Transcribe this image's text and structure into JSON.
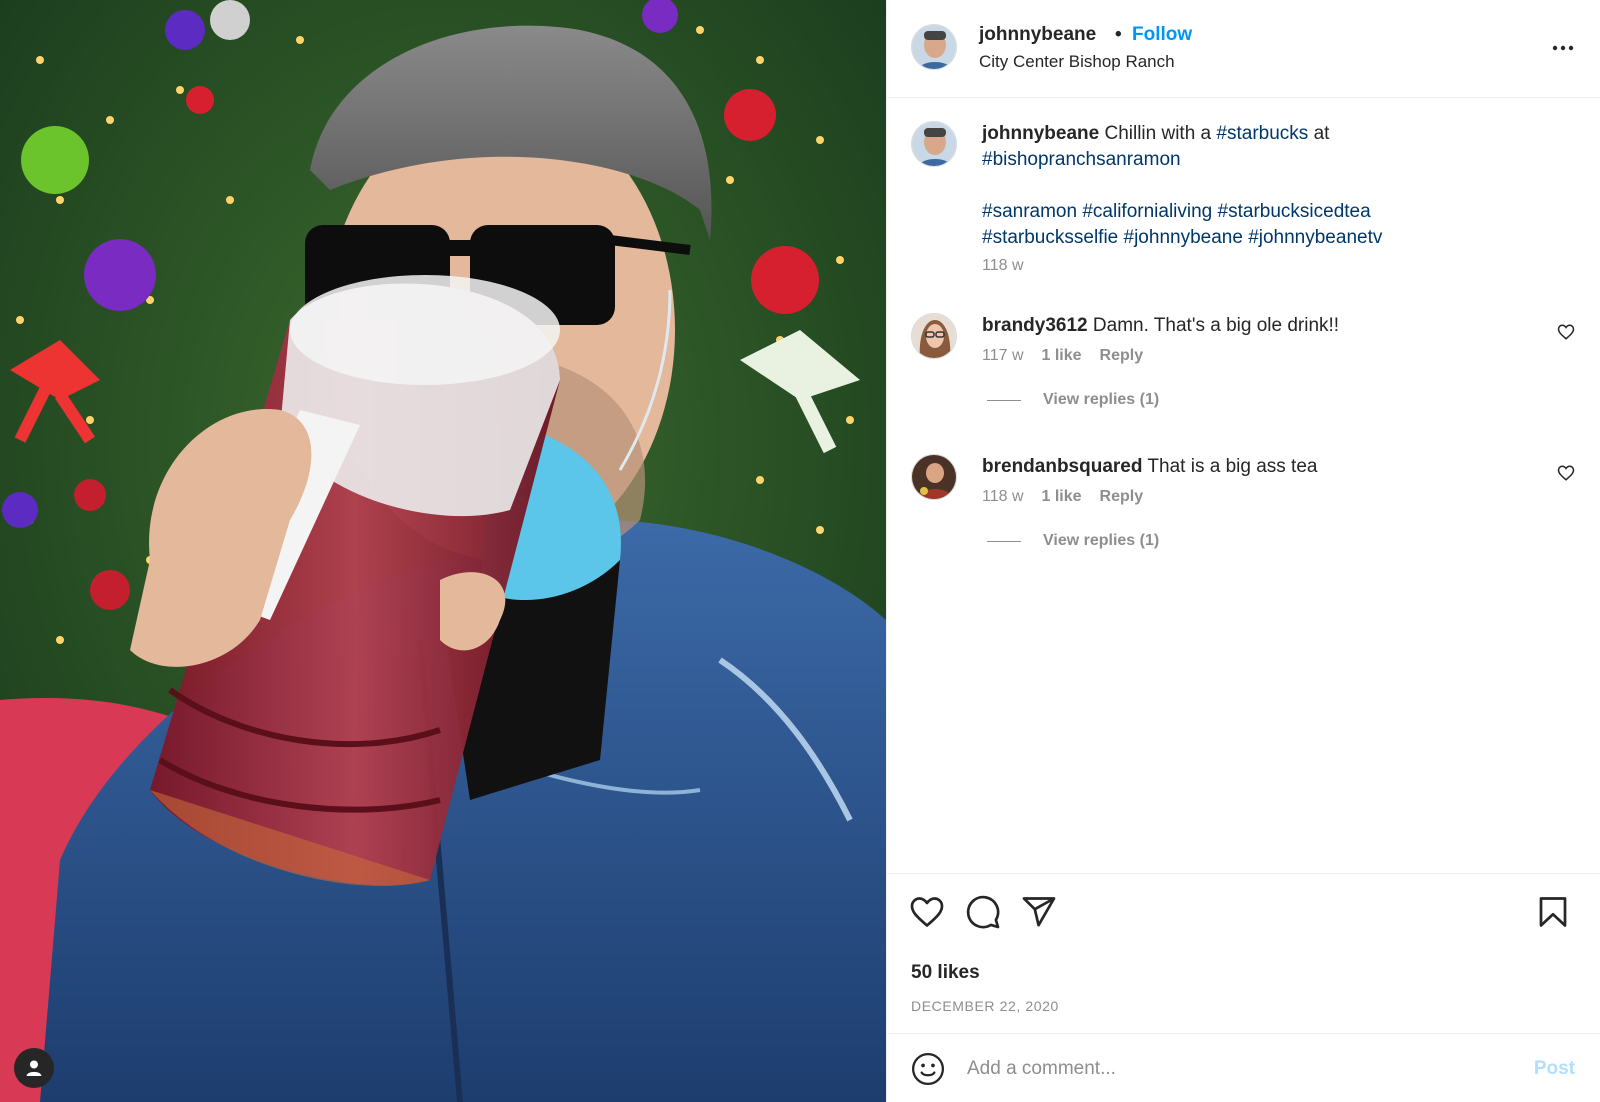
{
  "post": {
    "username": "johnnybeane",
    "follow_label": "Follow",
    "separator": "•",
    "location": "City Center Bishop Ranch",
    "caption": {
      "username": "johnnybeane",
      "text_1": "Chillin with a",
      "tag_1": "#starbucks",
      "text_2": "at",
      "tag_2": "#bishopranchsanramon",
      "tags_line_1": [
        "#sanramon",
        "#californialiving",
        "#starbucksicedtea"
      ],
      "tags_line_2": [
        "#starbucksselfie",
        "#johnnybeane",
        "#johnnybeanetv"
      ],
      "time": "118 w"
    },
    "comments": [
      {
        "username": "brandy3612",
        "text": "Damn. That's a big ole drink!!",
        "time": "117 w",
        "likes": "1 like",
        "reply_label": "Reply",
        "view_replies": "View replies (1)"
      },
      {
        "username": "brendanbsquared",
        "text": "That is a big ass tea",
        "time": "118 w",
        "likes": "1 like",
        "reply_label": "Reply",
        "view_replies": "View replies (1)"
      }
    ],
    "likes_count": "50 likes",
    "date": "DECEMBER 22, 2020",
    "add_comment_placeholder": "Add a comment...",
    "post_button": "Post"
  },
  "colors": {
    "link_blue": "#0095f6",
    "hashtag": "#00376b",
    "muted": "#8e8e8e",
    "post_disabled": "#b2dffc"
  },
  "icons": {
    "more": "more-options-icon",
    "like": "heart-icon",
    "comment": "comment-icon",
    "share": "send-icon",
    "save": "bookmark-icon",
    "emoji": "emoji-icon",
    "tag": "user-tag-icon"
  }
}
